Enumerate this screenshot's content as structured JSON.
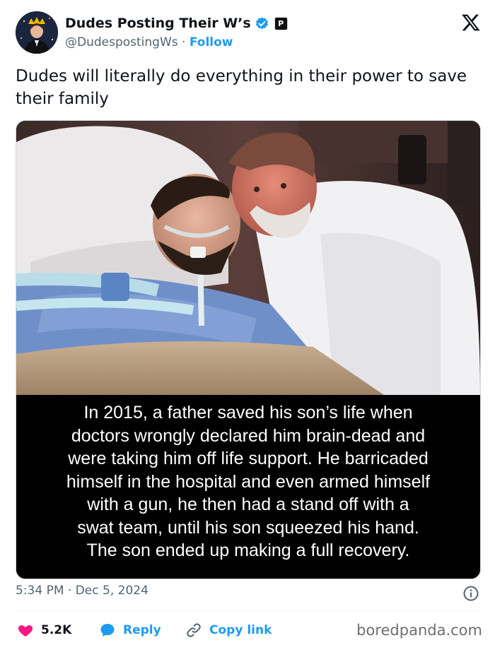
{
  "tweet": {
    "author": {
      "display_name": "Dudes Posting Their W’s",
      "handle": "@DudespostingWs",
      "separator": "·",
      "follow_label": "Follow",
      "verified_color": "#1d9bf0"
    },
    "text": "Dudes will literally do everything in their power to save their family",
    "media": {
      "caption_lines": [
        "In 2015, a father saved his son’s life when",
        "doctors wrongly declared him brain-dead and",
        "were taking him off life support. He barricaded",
        "himself in the hospital and even armed himself",
        "with a gun, he then had a stand off with a",
        "swat team, until his son squeezed his hand.",
        "The son ended up making a full recovery."
      ]
    },
    "timestamp": "5:34 PM · Dec 5, 2024",
    "actions": {
      "like_count": "5.2K",
      "reply_label": "Reply",
      "copy_label": "Copy link"
    },
    "icons": [
      "verified-badge-icon",
      "affiliate-badge-icon",
      "x-logo-icon",
      "info-icon",
      "heart-icon",
      "reply-bubble-icon",
      "link-icon"
    ],
    "colors": {
      "accent": "#1d9bf0",
      "like": "#f91880",
      "muted": "#536471"
    }
  },
  "watermark": "boredpanda.com"
}
